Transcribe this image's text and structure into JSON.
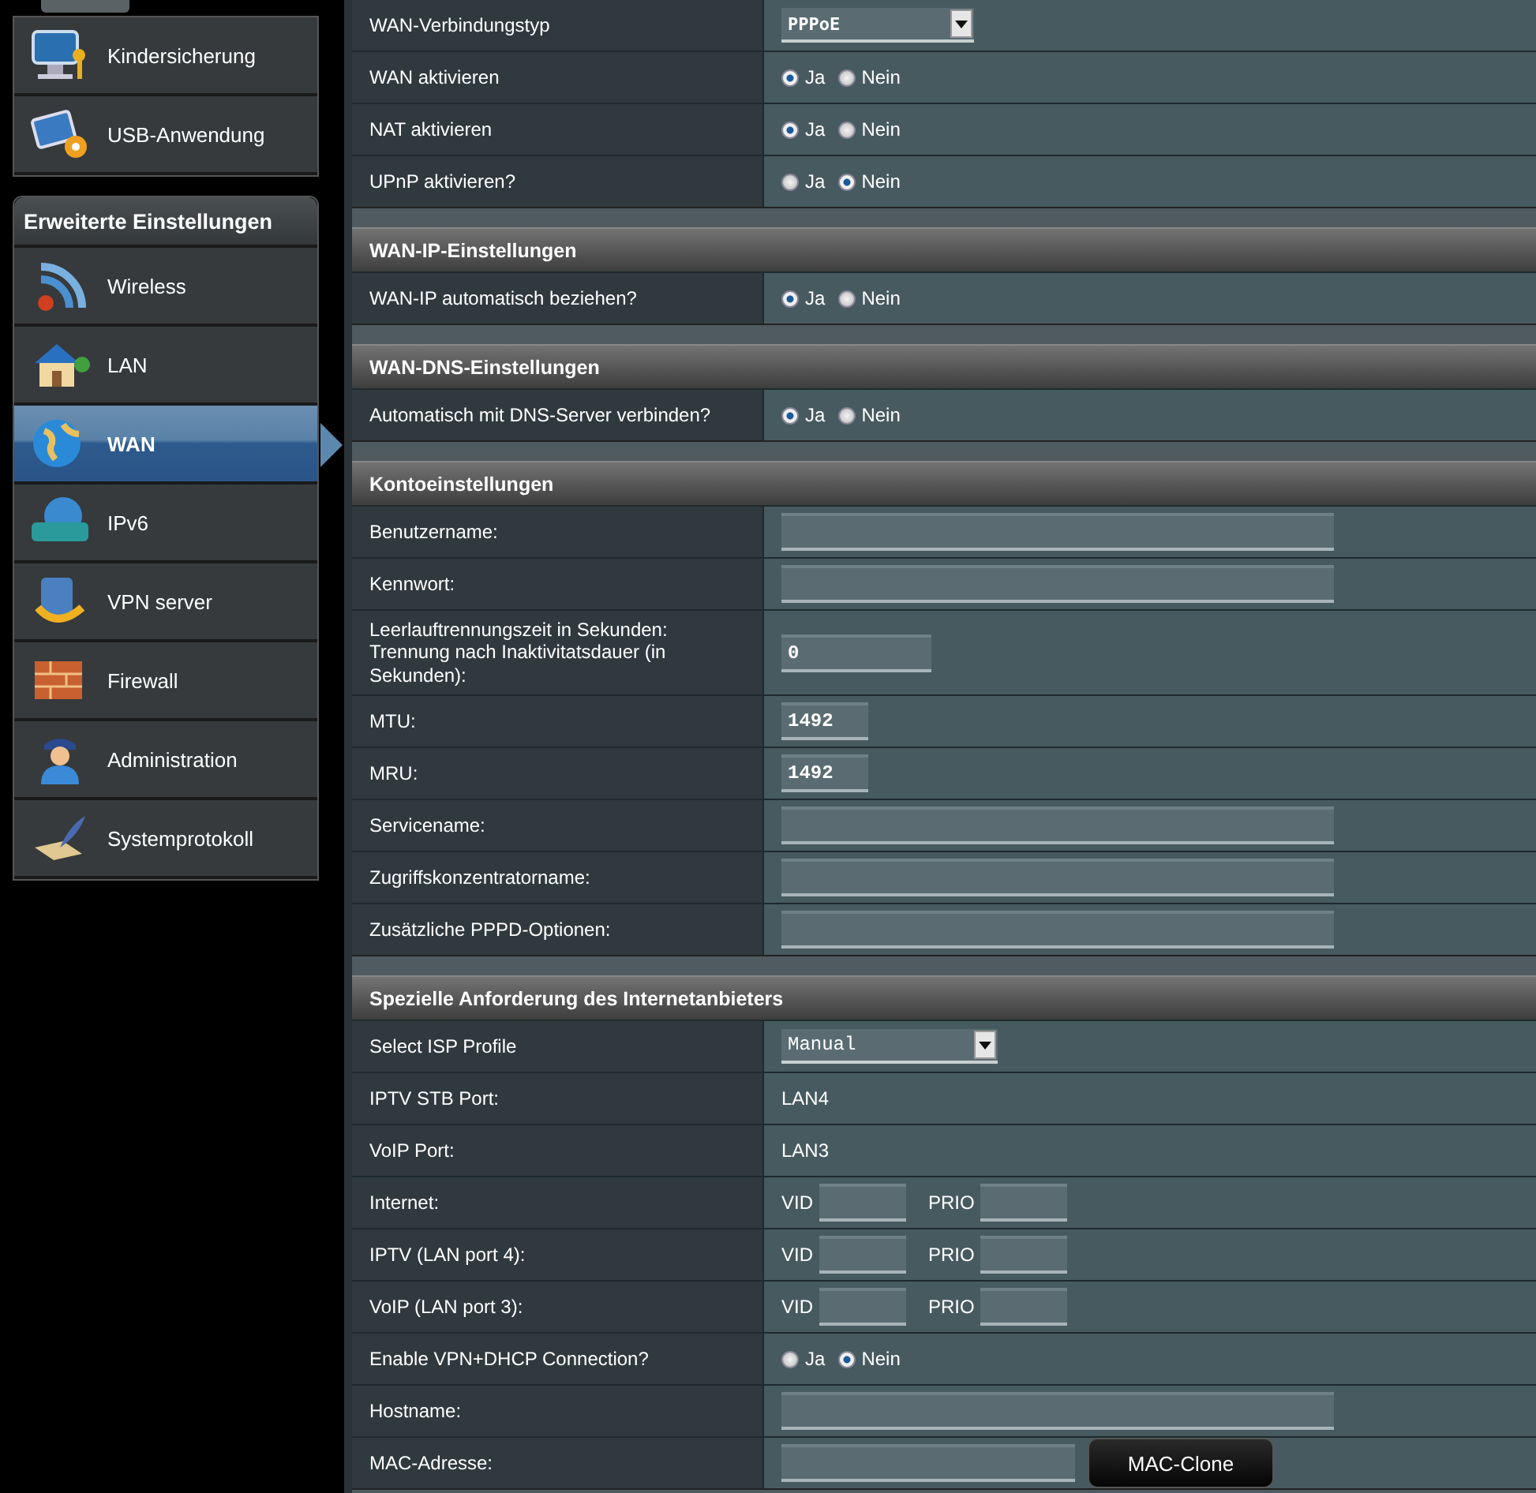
{
  "sidebar": {
    "items": [
      {
        "label": "Kindersicherung",
        "selected": false
      },
      {
        "label": "USB-Anwendung",
        "selected": false
      }
    ],
    "group_title": "Erweiterte Einstellungen",
    "group_items": [
      {
        "label": "Wireless",
        "selected": false
      },
      {
        "label": "LAN",
        "selected": false
      },
      {
        "label": "WAN",
        "selected": true
      },
      {
        "label": "IPv6",
        "selected": false
      },
      {
        "label": "VPN server",
        "selected": false
      },
      {
        "label": "Firewall",
        "selected": false
      },
      {
        "label": "Administration",
        "selected": false
      },
      {
        "label": "Systemprotokoll",
        "selected": false
      }
    ]
  },
  "sections": [
    {
      "rows": [
        {
          "label": "WAN-Verbindungstyp",
          "kind": "combo",
          "value": "PPPoE"
        },
        {
          "label": "WAN aktivieren",
          "kind": "radio",
          "options": [
            {
              "label": "Ja",
              "selected": true
            },
            {
              "label": "Nein",
              "selected": false
            }
          ]
        },
        {
          "label": "NAT aktivieren",
          "kind": "radio",
          "options": [
            {
              "label": "Ja",
              "selected": true
            },
            {
              "label": "Nein",
              "selected": false
            }
          ]
        },
        {
          "label": "UPnP aktivieren?",
          "kind": "radio",
          "options": [
            {
              "label": "Ja",
              "selected": false
            },
            {
              "label": "Nein",
              "selected": true
            }
          ]
        }
      ]
    },
    {
      "title": "WAN-IP-Einstellungen",
      "rows": [
        {
          "label": "WAN-IP automatisch beziehen?",
          "kind": "radio",
          "options": [
            {
              "label": "Ja",
              "selected": true
            },
            {
              "label": "Nein",
              "selected": false
            }
          ]
        }
      ]
    },
    {
      "title": "WAN-DNS-Einstellungen",
      "rows": [
        {
          "label": "Automatisch mit DNS-Server verbinden?",
          "kind": "radio",
          "options": [
            {
              "label": "Ja",
              "selected": true
            },
            {
              "label": "Nein",
              "selected": false
            }
          ]
        }
      ]
    },
    {
      "title": "Kontoeinstellungen",
      "rows": [
        {
          "label": "Benutzername:",
          "kind": "wide_input"
        },
        {
          "label": "Kennwort:",
          "kind": "wide_input"
        },
        {
          "label": "Leerlauftrennungszeit in Sekunden: Trennung nach Inaktivitatsdauer (in Sekunden):",
          "kind": "mid_input",
          "value": "0"
        },
        {
          "label": "MTU:",
          "kind": "narrow_input",
          "value": "1492"
        },
        {
          "label": "MRU:",
          "kind": "narrow_input",
          "value": "1492"
        },
        {
          "label": "Servicename:",
          "kind": "wide_input"
        },
        {
          "label": "Zugriffskonzentratorname:",
          "kind": "wide_input"
        },
        {
          "label": "Zusätzliche PPPD-Optionen:",
          "kind": "wide_input"
        }
      ]
    },
    {
      "title": "Spezielle Anforderung des Internetanbieters",
      "rows": [
        {
          "label": "Select ISP Profile",
          "kind": "select",
          "value": "Manual"
        },
        {
          "label": "IPTV STB Port:",
          "kind": "text",
          "value": "LAN4"
        },
        {
          "label": "VoIP Port:",
          "kind": "text",
          "value": "LAN3"
        },
        {
          "label": "Internet:",
          "kind": "vid_prio",
          "fields": [
            "VID",
            "PRIO"
          ]
        },
        {
          "label": "IPTV (LAN port 4):",
          "kind": "vid_prio",
          "fields": [
            "VID",
            "PRIO"
          ]
        },
        {
          "label": "VoIP (LAN port 3):",
          "kind": "vid_prio",
          "fields": [
            "VID",
            "PRIO"
          ]
        },
        {
          "label": "Enable VPN+DHCP Connection?",
          "kind": "radio",
          "options": [
            {
              "label": "Ja",
              "selected": false
            },
            {
              "label": "Nein",
              "selected": true
            }
          ]
        },
        {
          "label": "Hostname:",
          "kind": "wide_input"
        },
        {
          "label": "MAC-Adresse:",
          "kind": "input_button",
          "button": "MAC-Clone"
        }
      ]
    }
  ]
}
